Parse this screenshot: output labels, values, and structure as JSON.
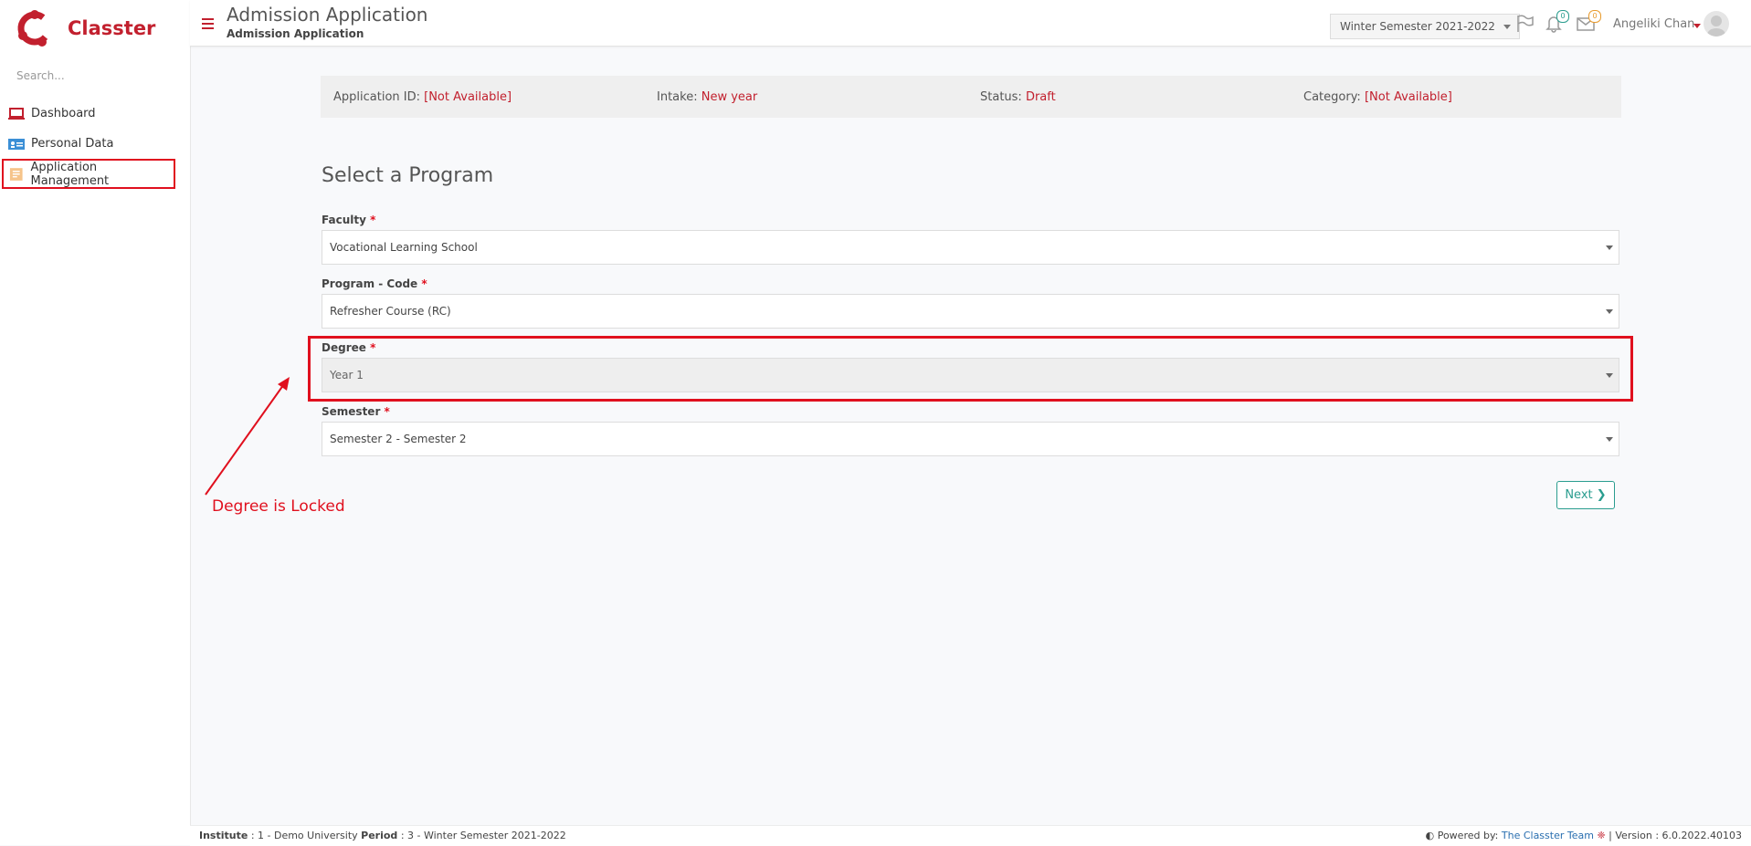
{
  "sidebar": {
    "brand": "Classter",
    "search_placeholder": "Search...",
    "items": [
      {
        "label": "Dashboard",
        "icon": "laptop-icon"
      },
      {
        "label": "Personal Data",
        "icon": "id-card-icon"
      },
      {
        "label": "Application Management",
        "icon": "document-icon"
      }
    ]
  },
  "header": {
    "title": "Admission Application",
    "subtitle": "Admission Application",
    "semester": "Winter Semester 2021-2022",
    "notifications_count": "0",
    "messages_count": "0",
    "user_name": "Angeliki Chan"
  },
  "info": {
    "application_id_label": "Application ID:",
    "application_id_value": "[Not Available]",
    "intake_label": "Intake:",
    "intake_value": "New year",
    "status_label": "Status:",
    "status_value": "Draft",
    "category_label": "Category:",
    "category_value": "[Not Available]"
  },
  "form": {
    "title": "Select a Program",
    "faculty_label": "Faculty",
    "faculty_value": "Vocational Learning School",
    "program_label": "Program - Code",
    "program_value": "Refresher Course (RC)",
    "degree_label": "Degree",
    "degree_value": "Year 1",
    "semester_label": "Semester",
    "semester_value": "Semester 2 - Semester 2",
    "required_mark": "*",
    "next_label": "Next"
  },
  "annotation": {
    "text": "Degree is Locked",
    "color": "#e0101e"
  },
  "footer": {
    "institute_label": "Institute",
    "institute_value": ": 1 - Demo University",
    "period_label": "Period",
    "period_value": ": 3 - Winter Semester 2021-2022",
    "powered_by": "Powered by:",
    "team": "The Classter Team",
    "version": "| Version : 6.0.2022.40103"
  },
  "colors": {
    "brand": "#c2202e",
    "accent": "#2a9d8f"
  }
}
